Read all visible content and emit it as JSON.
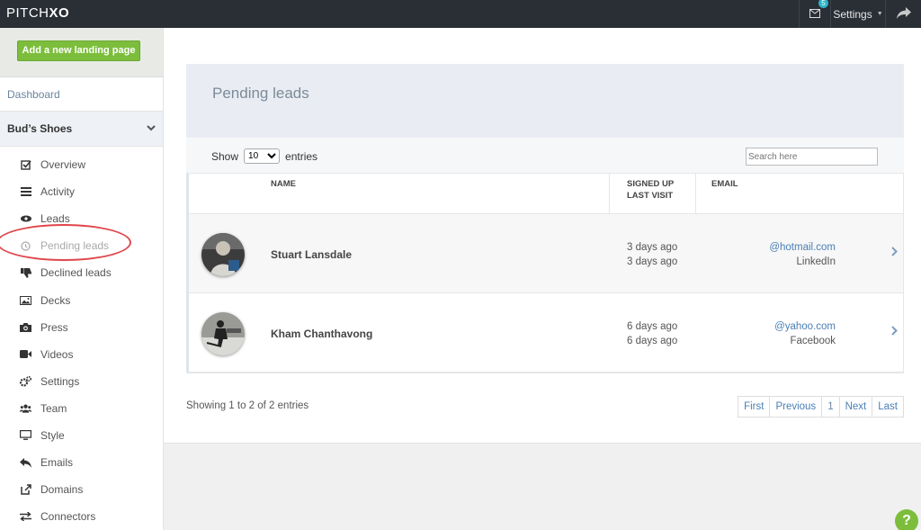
{
  "brand": {
    "logo_light": "PITCH",
    "logo_bold": "XO"
  },
  "topbar": {
    "mail_badge": "5",
    "settings_label": "Settings"
  },
  "sidebar": {
    "add_button": "Add a new landing page",
    "dashboard": "Dashboard",
    "group": "Bud’s Shoes",
    "items": [
      {
        "label": "Overview",
        "icon": "check-square-icon"
      },
      {
        "label": "Activity",
        "icon": "list-icon"
      },
      {
        "label": "Leads",
        "icon": "eye-icon"
      },
      {
        "label": "Pending leads",
        "icon": "clock-icon"
      },
      {
        "label": "Declined leads",
        "icon": "thumbs-down-icon"
      },
      {
        "label": "Decks",
        "icon": "image-icon"
      },
      {
        "label": "Press",
        "icon": "camera-icon"
      },
      {
        "label": "Videos",
        "icon": "video-icon"
      },
      {
        "label": "Settings",
        "icon": "gears-icon"
      },
      {
        "label": "Team",
        "icon": "users-icon"
      },
      {
        "label": "Style",
        "icon": "monitor-icon"
      },
      {
        "label": "Emails",
        "icon": "reply-icon"
      },
      {
        "label": "Domains",
        "icon": "external-link-icon"
      },
      {
        "label": "Connectors",
        "icon": "exchange-icon"
      }
    ]
  },
  "main": {
    "title": "Pending leads",
    "show_label": "Show",
    "entries_value": "10",
    "entries_label": "entries",
    "search_placeholder": "Search here",
    "columns": {
      "name": "NAME",
      "signed_up": "SIGNED UP",
      "last_visit": "LAST VISIT",
      "email": "EMAIL"
    },
    "rows": [
      {
        "name": "Stuart Lansdale",
        "signed_up": "3 days ago",
        "last_visit": "3 days ago",
        "email": "@hotmail.com",
        "source": "LinkedIn"
      },
      {
        "name": "Kham Chanthavong",
        "signed_up": "6 days ago",
        "last_visit": "6 days ago",
        "email": "@yahoo.com",
        "source": "Facebook"
      }
    ],
    "info": "Showing 1 to 2 of 2 entries",
    "pager": {
      "first": "First",
      "previous": "Previous",
      "page": "1",
      "next": "Next",
      "last": "Last"
    }
  },
  "help": "?"
}
